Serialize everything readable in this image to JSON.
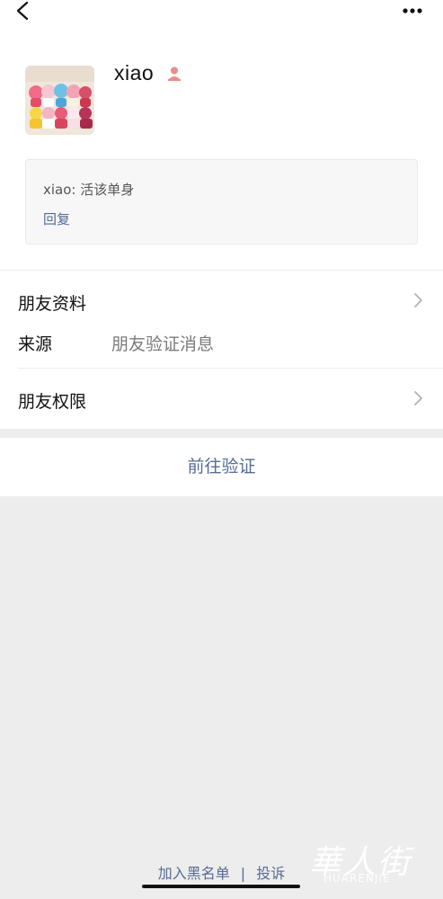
{
  "profile": {
    "name": "xiao",
    "message_text": "xiao: 活该单身",
    "reply_label": "回复"
  },
  "rows": {
    "friend_info_label": "朋友资料",
    "source_label": "来源",
    "source_value": "朋友验证消息",
    "friend_permissions_label": "朋友权限"
  },
  "action": {
    "verify_label": "前往验证"
  },
  "footer": {
    "blacklist_label": "加入黑名单",
    "separator": "|",
    "report_label": "投诉"
  },
  "watermark": {
    "chinese": "華人街",
    "latin": "HUARENJIE"
  },
  "icons": {
    "back": "chevron-left-icon",
    "more": "more-dots-icon",
    "gender": "female-icon",
    "row_chevron": "chevron-right-icon"
  },
  "colors": {
    "link_blue": "#576b95",
    "gender_pink": "#f08a8a",
    "background_gray": "#ededed"
  }
}
